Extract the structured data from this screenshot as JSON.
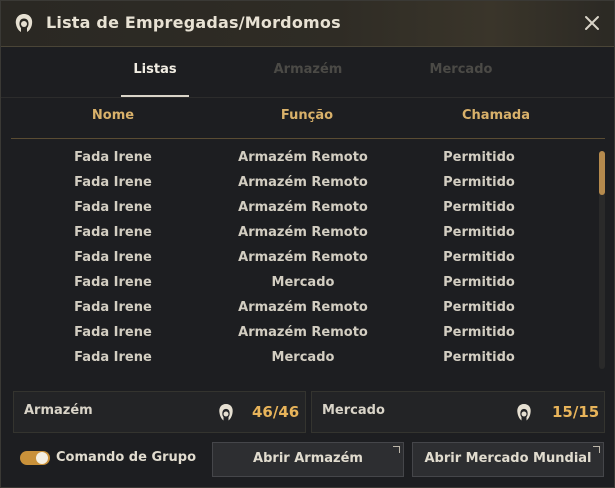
{
  "window": {
    "title": "Lista de Empregadas/Mordomos",
    "icons": {
      "title": "maid-icon",
      "close": "close-icon"
    }
  },
  "tabs": [
    {
      "label": "Listas",
      "active": true
    },
    {
      "label": "Armazém",
      "active": false
    },
    {
      "label": "Mercado",
      "active": false
    }
  ],
  "table": {
    "columns": [
      "Nome",
      "Função",
      "Chamada"
    ],
    "rows": [
      [
        "Fada Irene",
        "Armazém Remoto",
        "Permitido"
      ],
      [
        "Fada Irene",
        "Armazém Remoto",
        "Permitido"
      ],
      [
        "Fada Irene",
        "Armazém Remoto",
        "Permitido"
      ],
      [
        "Fada Irene",
        "Armazém Remoto",
        "Permitido"
      ],
      [
        "Fada Irene",
        "Armazém Remoto",
        "Permitido"
      ],
      [
        "Fada Irene",
        "Mercado",
        "Permitido"
      ],
      [
        "Fada Irene",
        "Armazém Remoto",
        "Permitido"
      ],
      [
        "Fada Irene",
        "Armazém Remoto",
        "Permitido"
      ],
      [
        "Fada Irene",
        "Mercado",
        "Permitido"
      ]
    ]
  },
  "counters": {
    "warehouse": {
      "label": "Armazém",
      "value": "46/46",
      "icon": "maid-icon"
    },
    "market": {
      "label": "Mercado",
      "value": "15/15",
      "icon": "maid-icon"
    }
  },
  "footer": {
    "group_command_label": "Comando de Grupo",
    "group_command_on": true,
    "open_warehouse_label": "Abrir Armazém",
    "open_market_label": "Abrir Mercado Mundial"
  },
  "colors": {
    "accent": "#d9b16a",
    "counter_value": "#e8b45a",
    "toggle_on": "#c9913a"
  }
}
